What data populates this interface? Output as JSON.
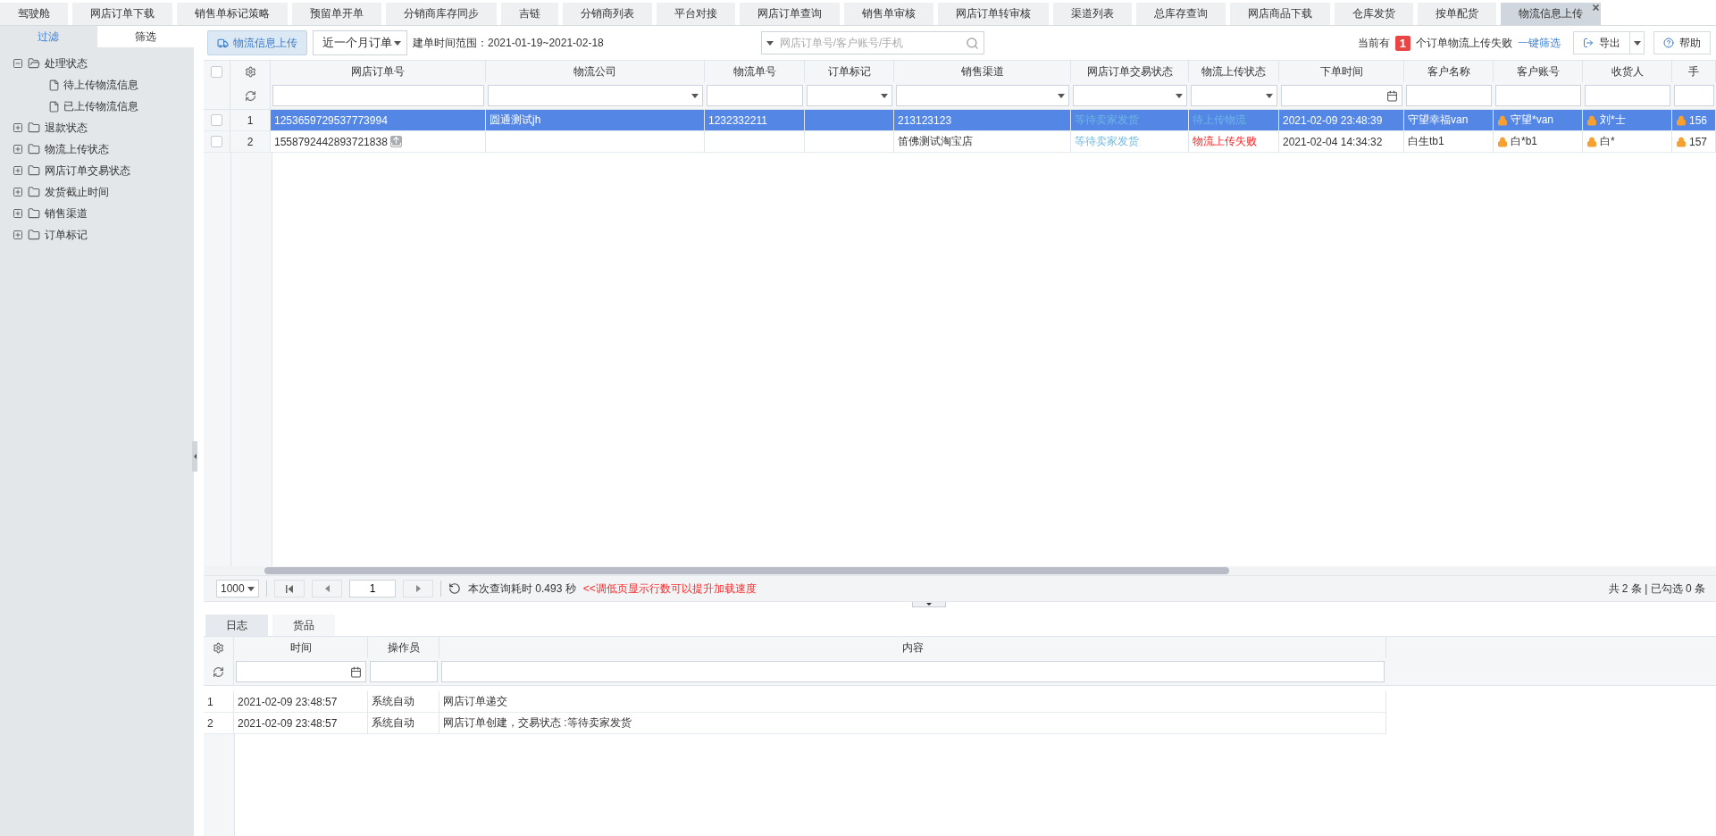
{
  "tabs": [
    {
      "label": "驾驶舱",
      "selected": false
    },
    {
      "label": "网店订单下载",
      "selected": false
    },
    {
      "label": "销售单标记策略",
      "selected": false
    },
    {
      "label": "预留单开单",
      "selected": false
    },
    {
      "label": "分销商库存同步",
      "selected": false
    },
    {
      "label": "吉链",
      "selected": false
    },
    {
      "label": "分销商列表",
      "selected": false
    },
    {
      "label": "平台对接",
      "selected": false
    },
    {
      "label": "网店订单查询",
      "selected": false
    },
    {
      "label": "销售单审核",
      "selected": false
    },
    {
      "label": "网店订单转审核",
      "selected": false
    },
    {
      "label": "渠道列表",
      "selected": false
    },
    {
      "label": "总库存查询",
      "selected": false
    },
    {
      "label": "网店商品下载",
      "selected": false
    },
    {
      "label": "仓库发货",
      "selected": false
    },
    {
      "label": "按单配货",
      "selected": false
    },
    {
      "label": "物流信息上传",
      "selected": true
    }
  ],
  "sidebar": {
    "tabs": [
      {
        "label": "过滤",
        "selected": true
      },
      {
        "label": "筛选",
        "selected": false
      }
    ],
    "tree": [
      {
        "label": "处理状态",
        "expanded": true,
        "children": [
          {
            "label": "待上传物流信息"
          },
          {
            "label": "已上传物流信息"
          }
        ]
      },
      {
        "label": "退款状态",
        "expanded": false
      },
      {
        "label": "物流上传状态",
        "expanded": false
      },
      {
        "label": "网店订单交易状态",
        "expanded": false
      },
      {
        "label": "发货截止时间",
        "expanded": false
      },
      {
        "label": "销售渠道",
        "expanded": false
      },
      {
        "label": "订单标记",
        "expanded": false
      }
    ]
  },
  "toolbar": {
    "upload_button": "物流信息上传",
    "period_select": "近一个月订单",
    "range_label": "建单时间范围：2021-01-19~2021-02-18",
    "search": {
      "placeholder": "网店订单号/客户账号/手机"
    },
    "notice_prefix": "当前有",
    "notice_count": "1",
    "notice_suffix": "个订单物流上传失败",
    "notice_link": "一键筛选",
    "export_button": "导出",
    "help_button": "帮助"
  },
  "grid": {
    "all_checked": false,
    "columns": [
      {
        "label": "网店订单号",
        "kind": "text"
      },
      {
        "label": "物流公司",
        "kind": "select"
      },
      {
        "label": "物流单号",
        "kind": "text"
      },
      {
        "label": "订单标记",
        "kind": "select"
      },
      {
        "label": "销售渠道",
        "kind": "select"
      },
      {
        "label": "网店订单交易状态",
        "kind": "select"
      },
      {
        "label": "物流上传状态",
        "kind": "select"
      },
      {
        "label": "下单时间",
        "kind": "date"
      },
      {
        "label": "客户名称",
        "kind": "text"
      },
      {
        "label": "客户账号",
        "kind": "text"
      },
      {
        "label": "收货人",
        "kind": "text"
      },
      {
        "label": "手",
        "kind": "text"
      }
    ],
    "rows": [
      {
        "index": "1",
        "selected": true,
        "checked": false,
        "cells": [
          {
            "text": "1253659729537773994",
            "kind": "plain"
          },
          {
            "text": "圆通测试jh",
            "kind": "plain"
          },
          {
            "text": "1232332211",
            "kind": "plain"
          },
          {
            "text": "",
            "kind": "plain"
          },
          {
            "text": "213123123",
            "kind": "plain"
          },
          {
            "text": "等待卖家发货",
            "kind": "status",
            "color": "#6cb8e0"
          },
          {
            "text": "待上传物流",
            "kind": "status",
            "color": "#6cb8e0"
          },
          {
            "text": "2021-02-09 23:48:39",
            "kind": "plain"
          },
          {
            "text": "守望幸福van",
            "kind": "plain"
          },
          {
            "text": "守望*van",
            "kind": "masked"
          },
          {
            "text": "刘*士",
            "kind": "masked"
          },
          {
            "text": "156",
            "kind": "masked"
          }
        ]
      },
      {
        "index": "2",
        "selected": false,
        "checked": false,
        "cells": [
          {
            "text": "1558792442893721838",
            "kind": "flagged"
          },
          {
            "text": "",
            "kind": "plain"
          },
          {
            "text": "",
            "kind": "plain"
          },
          {
            "text": "",
            "kind": "plain"
          },
          {
            "text": "笛佛测试淘宝店",
            "kind": "plain"
          },
          {
            "text": "等待卖家发货",
            "kind": "status",
            "color": "#6cb8e0"
          },
          {
            "text": "物流上传失败",
            "kind": "status",
            "color": "#ff2020"
          },
          {
            "text": "2021-02-04 14:34:32",
            "kind": "plain"
          },
          {
            "text": "白生tb1",
            "kind": "plain"
          },
          {
            "text": "白*b1",
            "kind": "masked"
          },
          {
            "text": "白*",
            "kind": "masked"
          },
          {
            "text": "157",
            "kind": "masked"
          }
        ]
      }
    ]
  },
  "pager": {
    "page_size": "1000",
    "page": "1",
    "query_time": "本次查询耗时 0.493 秒",
    "hint": "<<调低页显示行数可以提升加载速度",
    "summary": "共 2 条 | 已勾选 0 条"
  },
  "log": {
    "tabs": [
      {
        "label": "日志",
        "selected": true
      },
      {
        "label": "货品",
        "selected": false
      }
    ],
    "columns": [
      {
        "label": "时间",
        "kind": "date"
      },
      {
        "label": "操作员",
        "kind": "text"
      },
      {
        "label": "内容",
        "kind": "text"
      }
    ],
    "rows": [
      {
        "index": "1",
        "cells": [
          "2021-02-09 23:48:57",
          "系统自动",
          "网店订单递交"
        ]
      },
      {
        "index": "2",
        "cells": [
          "2021-02-09 23:48:57",
          "系统自动",
          "网店订单创建，交易状态 :等待卖家发货"
        ]
      }
    ]
  }
}
